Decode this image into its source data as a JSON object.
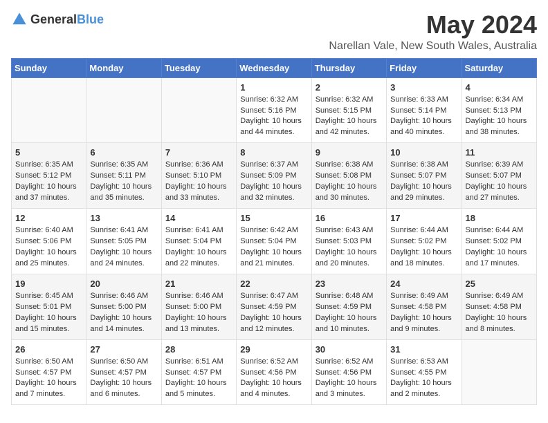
{
  "logo": {
    "general": "General",
    "blue": "Blue"
  },
  "title": {
    "month": "May 2024",
    "location": "Narellan Vale, New South Wales, Australia"
  },
  "weekdays": [
    "Sunday",
    "Monday",
    "Tuesday",
    "Wednesday",
    "Thursday",
    "Friday",
    "Saturday"
  ],
  "weeks": [
    [
      {
        "day": "",
        "info": ""
      },
      {
        "day": "",
        "info": ""
      },
      {
        "day": "",
        "info": ""
      },
      {
        "day": "1",
        "info": "Sunrise: 6:32 AM\nSunset: 5:16 PM\nDaylight: 10 hours\nand 44 minutes."
      },
      {
        "day": "2",
        "info": "Sunrise: 6:32 AM\nSunset: 5:15 PM\nDaylight: 10 hours\nand 42 minutes."
      },
      {
        "day": "3",
        "info": "Sunrise: 6:33 AM\nSunset: 5:14 PM\nDaylight: 10 hours\nand 40 minutes."
      },
      {
        "day": "4",
        "info": "Sunrise: 6:34 AM\nSunset: 5:13 PM\nDaylight: 10 hours\nand 38 minutes."
      }
    ],
    [
      {
        "day": "5",
        "info": "Sunrise: 6:35 AM\nSunset: 5:12 PM\nDaylight: 10 hours\nand 37 minutes."
      },
      {
        "day": "6",
        "info": "Sunrise: 6:35 AM\nSunset: 5:11 PM\nDaylight: 10 hours\nand 35 minutes."
      },
      {
        "day": "7",
        "info": "Sunrise: 6:36 AM\nSunset: 5:10 PM\nDaylight: 10 hours\nand 33 minutes."
      },
      {
        "day": "8",
        "info": "Sunrise: 6:37 AM\nSunset: 5:09 PM\nDaylight: 10 hours\nand 32 minutes."
      },
      {
        "day": "9",
        "info": "Sunrise: 6:38 AM\nSunset: 5:08 PM\nDaylight: 10 hours\nand 30 minutes."
      },
      {
        "day": "10",
        "info": "Sunrise: 6:38 AM\nSunset: 5:07 PM\nDaylight: 10 hours\nand 29 minutes."
      },
      {
        "day": "11",
        "info": "Sunrise: 6:39 AM\nSunset: 5:07 PM\nDaylight: 10 hours\nand 27 minutes."
      }
    ],
    [
      {
        "day": "12",
        "info": "Sunrise: 6:40 AM\nSunset: 5:06 PM\nDaylight: 10 hours\nand 25 minutes."
      },
      {
        "day": "13",
        "info": "Sunrise: 6:41 AM\nSunset: 5:05 PM\nDaylight: 10 hours\nand 24 minutes."
      },
      {
        "day": "14",
        "info": "Sunrise: 6:41 AM\nSunset: 5:04 PM\nDaylight: 10 hours\nand 22 minutes."
      },
      {
        "day": "15",
        "info": "Sunrise: 6:42 AM\nSunset: 5:04 PM\nDaylight: 10 hours\nand 21 minutes."
      },
      {
        "day": "16",
        "info": "Sunrise: 6:43 AM\nSunset: 5:03 PM\nDaylight: 10 hours\nand 20 minutes."
      },
      {
        "day": "17",
        "info": "Sunrise: 6:44 AM\nSunset: 5:02 PM\nDaylight: 10 hours\nand 18 minutes."
      },
      {
        "day": "18",
        "info": "Sunrise: 6:44 AM\nSunset: 5:02 PM\nDaylight: 10 hours\nand 17 minutes."
      }
    ],
    [
      {
        "day": "19",
        "info": "Sunrise: 6:45 AM\nSunset: 5:01 PM\nDaylight: 10 hours\nand 15 minutes."
      },
      {
        "day": "20",
        "info": "Sunrise: 6:46 AM\nSunset: 5:00 PM\nDaylight: 10 hours\nand 14 minutes."
      },
      {
        "day": "21",
        "info": "Sunrise: 6:46 AM\nSunset: 5:00 PM\nDaylight: 10 hours\nand 13 minutes."
      },
      {
        "day": "22",
        "info": "Sunrise: 6:47 AM\nSunset: 4:59 PM\nDaylight: 10 hours\nand 12 minutes."
      },
      {
        "day": "23",
        "info": "Sunrise: 6:48 AM\nSunset: 4:59 PM\nDaylight: 10 hours\nand 10 minutes."
      },
      {
        "day": "24",
        "info": "Sunrise: 6:49 AM\nSunset: 4:58 PM\nDaylight: 10 hours\nand 9 minutes."
      },
      {
        "day": "25",
        "info": "Sunrise: 6:49 AM\nSunset: 4:58 PM\nDaylight: 10 hours\nand 8 minutes."
      }
    ],
    [
      {
        "day": "26",
        "info": "Sunrise: 6:50 AM\nSunset: 4:57 PM\nDaylight: 10 hours\nand 7 minutes."
      },
      {
        "day": "27",
        "info": "Sunrise: 6:50 AM\nSunset: 4:57 PM\nDaylight: 10 hours\nand 6 minutes."
      },
      {
        "day": "28",
        "info": "Sunrise: 6:51 AM\nSunset: 4:57 PM\nDaylight: 10 hours\nand 5 minutes."
      },
      {
        "day": "29",
        "info": "Sunrise: 6:52 AM\nSunset: 4:56 PM\nDaylight: 10 hours\nand 4 minutes."
      },
      {
        "day": "30",
        "info": "Sunrise: 6:52 AM\nSunset: 4:56 PM\nDaylight: 10 hours\nand 3 minutes."
      },
      {
        "day": "31",
        "info": "Sunrise: 6:53 AM\nSunset: 4:55 PM\nDaylight: 10 hours\nand 2 minutes."
      },
      {
        "day": "",
        "info": ""
      }
    ]
  ]
}
